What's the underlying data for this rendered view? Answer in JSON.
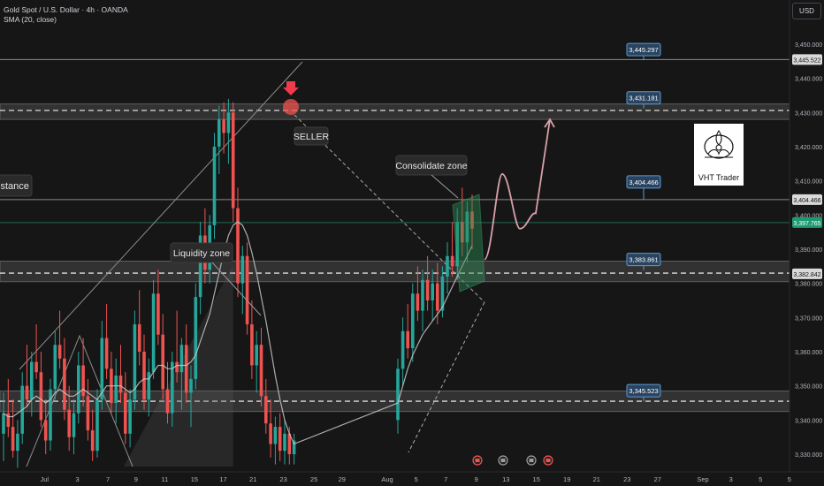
{
  "header": {
    "symbol_line": "Gold Spot / U.S. Dollar · 4h · OANDA",
    "indicator_line": "SMA (20, close)"
  },
  "currency_button": "USD",
  "logo": {
    "text": "VHT Trader"
  },
  "annotations": {
    "seller": "SELLER",
    "consolidate": "Consolidate zone",
    "liquidity": "Liquidity zone",
    "resistance_partial": "istance"
  },
  "colors": {
    "background": "#161616",
    "bull": "#26a69a",
    "bear": "#ef5350",
    "sma": "#c8c8c8",
    "zone_fill": "#4a4a4a",
    "label_box": "#2a4460",
    "label_border": "#5b9bd5",
    "price_box_green": "#1e9a72",
    "projection": "#d9a0aa",
    "consolidate_box": "#2e8b57"
  },
  "chart_data": {
    "type": "candlestick",
    "symbol": "Gold Spot / U.S. Dollar",
    "timeframe": "4h",
    "source": "OANDA",
    "indicator": "SMA (20, close)",
    "currency": "USD",
    "ylim": [
      3327,
      3453
    ],
    "y_ticks": [
      3330,
      3340,
      3350,
      3360,
      3370,
      3380,
      3390,
      3400,
      3410,
      3420,
      3430,
      3440,
      3450
    ],
    "y_tick_labels": [
      "3,330.000",
      "3,340.000",
      "3,350.000",
      "3,360.000",
      "3,370.000",
      "3,380.000",
      "3,390.000",
      "3,400.000",
      "3,410.000",
      "3,420.000",
      "3,430.000",
      "3,440.000",
      "3,450.000"
    ],
    "x_ticks": [
      {
        "label": "Jul",
        "pos": 0.054
      },
      {
        "label": "3",
        "pos": 0.094
      },
      {
        "label": "7",
        "pos": 0.131
      },
      {
        "label": "9",
        "pos": 0.165
      },
      {
        "label": "11",
        "pos": 0.2
      },
      {
        "label": "15",
        "pos": 0.236
      },
      {
        "label": "17",
        "pos": 0.271
      },
      {
        "label": "21",
        "pos": 0.307
      },
      {
        "label": "23",
        "pos": 0.344
      },
      {
        "label": "25",
        "pos": 0.381
      },
      {
        "label": "29",
        "pos": 0.415
      },
      {
        "label": "Aug",
        "pos": 0.47
      },
      {
        "label": "5",
        "pos": 0.505
      },
      {
        "label": "7",
        "pos": 0.541
      },
      {
        "label": "9",
        "pos": 0.578
      },
      {
        "label": "13",
        "pos": 0.614
      },
      {
        "label": "15",
        "pos": 0.651
      },
      {
        "label": "19",
        "pos": 0.688
      },
      {
        "label": "21",
        "pos": 0.724
      },
      {
        "label": "23",
        "pos": 0.761
      },
      {
        "label": "27",
        "pos": 0.798
      },
      {
        "label": "Sep",
        "pos": 0.853
      },
      {
        "label": "3",
        "pos": 0.887
      },
      {
        "label": "5",
        "pos": 0.923
      },
      {
        "label": "5",
        "pos": 0.958
      }
    ],
    "price_labels": [
      {
        "text": "3,445.297",
        "value": 3445.3
      },
      {
        "text": "3,431.181",
        "value": 3431.2
      },
      {
        "text": "3,404.466",
        "value": 3404.5
      },
      {
        "text": "3,383.861",
        "value": 3383.9
      },
      {
        "text": "3,345.523",
        "value": 3345.5
      }
    ],
    "right_labels": [
      {
        "text": "3,445.522",
        "value": 3445.5,
        "style": "white"
      },
      {
        "text": "3,404.466",
        "value": 3404.5,
        "style": "white"
      },
      {
        "text": "3,397.765",
        "value": 3397.8,
        "style": "green"
      },
      {
        "text": "3,382.842",
        "value": 3382.8,
        "style": "white"
      }
    ],
    "horizontal_lines": [
      3445.5,
      3404.5,
      3397.8
    ],
    "zones": [
      {
        "top": 3432.5,
        "bottom": 3428.0,
        "mid": 3430.6
      },
      {
        "top": 3386.5,
        "bottom": 3380.5,
        "mid": 3383.0
      },
      {
        "top": 3348.5,
        "bottom": 3342.5,
        "mid": 3345.5
      }
    ],
    "candles": [
      {
        "o": 3336,
        "h": 3348,
        "l": 3328,
        "c": 3342
      },
      {
        "o": 3342,
        "h": 3352,
        "l": 3335,
        "c": 3338
      },
      {
        "o": 3338,
        "h": 3346,
        "l": 3329,
        "c": 3331
      },
      {
        "o": 3331,
        "h": 3340,
        "l": 3326,
        "c": 3336
      },
      {
        "o": 3336,
        "h": 3354,
        "l": 3333,
        "c": 3350
      },
      {
        "o": 3350,
        "h": 3362,
        "l": 3344,
        "c": 3346
      },
      {
        "o": 3346,
        "h": 3360,
        "l": 3341,
        "c": 3357
      },
      {
        "o": 3357,
        "h": 3368,
        "l": 3352,
        "c": 3354
      },
      {
        "o": 3354,
        "h": 3360,
        "l": 3338,
        "c": 3340
      },
      {
        "o": 3340,
        "h": 3346,
        "l": 3330,
        "c": 3334
      },
      {
        "o": 3334,
        "h": 3352,
        "l": 3331,
        "c": 3349
      },
      {
        "o": 3349,
        "h": 3366,
        "l": 3346,
        "c": 3362
      },
      {
        "o": 3362,
        "h": 3372,
        "l": 3355,
        "c": 3358
      },
      {
        "o": 3358,
        "h": 3364,
        "l": 3340,
        "c": 3343
      },
      {
        "o": 3343,
        "h": 3350,
        "l": 3331,
        "c": 3335
      },
      {
        "o": 3335,
        "h": 3346,
        "l": 3330,
        "c": 3342
      },
      {
        "o": 3342,
        "h": 3360,
        "l": 3339,
        "c": 3356
      },
      {
        "o": 3356,
        "h": 3364,
        "l": 3344,
        "c": 3347
      },
      {
        "o": 3347,
        "h": 3352,
        "l": 3334,
        "c": 3337
      },
      {
        "o": 3337,
        "h": 3343,
        "l": 3328,
        "c": 3331
      },
      {
        "o": 3331,
        "h": 3349,
        "l": 3329,
        "c": 3346
      },
      {
        "o": 3346,
        "h": 3369,
        "l": 3343,
        "c": 3364
      },
      {
        "o": 3364,
        "h": 3374,
        "l": 3352,
        "c": 3355
      },
      {
        "o": 3355,
        "h": 3360,
        "l": 3342,
        "c": 3345
      },
      {
        "o": 3345,
        "h": 3358,
        "l": 3339,
        "c": 3353
      },
      {
        "o": 3353,
        "h": 3362,
        "l": 3345,
        "c": 3348
      },
      {
        "o": 3348,
        "h": 3354,
        "l": 3333,
        "c": 3336
      },
      {
        "o": 3336,
        "h": 3349,
        "l": 3332,
        "c": 3346
      },
      {
        "o": 3346,
        "h": 3372,
        "l": 3343,
        "c": 3368
      },
      {
        "o": 3368,
        "h": 3378,
        "l": 3356,
        "c": 3360
      },
      {
        "o": 3360,
        "h": 3365,
        "l": 3343,
        "c": 3346
      },
      {
        "o": 3346,
        "h": 3358,
        "l": 3341,
        "c": 3354
      },
      {
        "o": 3354,
        "h": 3381,
        "l": 3352,
        "c": 3377
      },
      {
        "o": 3377,
        "h": 3384,
        "l": 3362,
        "c": 3365
      },
      {
        "o": 3365,
        "h": 3371,
        "l": 3346,
        "c": 3349
      },
      {
        "o": 3349,
        "h": 3357,
        "l": 3339,
        "c": 3342
      },
      {
        "o": 3342,
        "h": 3360,
        "l": 3338,
        "c": 3357
      },
      {
        "o": 3357,
        "h": 3372,
        "l": 3351,
        "c": 3354
      },
      {
        "o": 3354,
        "h": 3364,
        "l": 3343,
        "c": 3362
      },
      {
        "o": 3362,
        "h": 3368,
        "l": 3345,
        "c": 3348
      },
      {
        "o": 3348,
        "h": 3356,
        "l": 3338,
        "c": 3352
      },
      {
        "o": 3352,
        "h": 3380,
        "l": 3349,
        "c": 3376
      },
      {
        "o": 3376,
        "h": 3398,
        "l": 3371,
        "c": 3394
      },
      {
        "o": 3394,
        "h": 3402,
        "l": 3380,
        "c": 3384
      },
      {
        "o": 3384,
        "h": 3400,
        "l": 3380,
        "c": 3397
      },
      {
        "o": 3397,
        "h": 3424,
        "l": 3393,
        "c": 3420
      },
      {
        "o": 3420,
        "h": 3432,
        "l": 3412,
        "c": 3428
      },
      {
        "o": 3428,
        "h": 3433,
        "l": 3418,
        "c": 3424
      },
      {
        "o": 3424,
        "h": 3434,
        "l": 3415,
        "c": 3430
      },
      {
        "o": 3430,
        "h": 3433,
        "l": 3398,
        "c": 3402
      },
      {
        "o": 3402,
        "h": 3408,
        "l": 3376,
        "c": 3380
      },
      {
        "o": 3380,
        "h": 3391,
        "l": 3371,
        "c": 3388
      },
      {
        "o": 3388,
        "h": 3392,
        "l": 3365,
        "c": 3368
      },
      {
        "o": 3368,
        "h": 3375,
        "l": 3352,
        "c": 3356
      },
      {
        "o": 3356,
        "h": 3366,
        "l": 3348,
        "c": 3362
      },
      {
        "o": 3362,
        "h": 3367,
        "l": 3344,
        "c": 3347
      },
      {
        "o": 3347,
        "h": 3352,
        "l": 3336,
        "c": 3339
      },
      {
        "o": 3339,
        "h": 3346,
        "l": 3329,
        "c": 3333
      },
      {
        "o": 3333,
        "h": 3341,
        "l": 3327,
        "c": 3338
      },
      {
        "o": 3338,
        "h": 3342,
        "l": 3328,
        "c": 3331
      },
      {
        "o": 3331,
        "h": 3340,
        "l": 3327,
        "c": 3336
      },
      {
        "o": 3336,
        "h": 3338,
        "l": 3327,
        "c": 3330
      },
      {
        "o": 3330,
        "h": 3336,
        "l": 3327,
        "c": 3334
      },
      {
        "o": 3340,
        "h": 3358,
        "l": 3336,
        "c": 3355
      },
      {
        "o": 3355,
        "h": 3370,
        "l": 3350,
        "c": 3366
      },
      {
        "o": 3366,
        "h": 3374,
        "l": 3358,
        "c": 3361
      },
      {
        "o": 3361,
        "h": 3380,
        "l": 3357,
        "c": 3377
      },
      {
        "o": 3377,
        "h": 3385,
        "l": 3369,
        "c": 3372
      },
      {
        "o": 3372,
        "h": 3384,
        "l": 3366,
        "c": 3381
      },
      {
        "o": 3381,
        "h": 3388,
        "l": 3372,
        "c": 3375
      },
      {
        "o": 3375,
        "h": 3384,
        "l": 3369,
        "c": 3380
      },
      {
        "o": 3380,
        "h": 3386,
        "l": 3368,
        "c": 3372
      },
      {
        "o": 3372,
        "h": 3385,
        "l": 3370,
        "c": 3382
      },
      {
        "o": 3382,
        "h": 3392,
        "l": 3377,
        "c": 3388
      },
      {
        "o": 3388,
        "h": 3398,
        "l": 3382,
        "c": 3385
      },
      {
        "o": 3385,
        "h": 3402,
        "l": 3381,
        "c": 3398
      },
      {
        "o": 3398,
        "h": 3408,
        "l": 3388,
        "c": 3392
      },
      {
        "o": 3392,
        "h": 3404,
        "l": 3386,
        "c": 3401
      },
      {
        "o": 3401,
        "h": 3406,
        "l": 3390,
        "c": 3396
      }
    ],
    "sma": [
      3342,
      3341,
      3341,
      3342,
      3343,
      3344,
      3346,
      3347,
      3346,
      3345,
      3346,
      3348,
      3349,
      3348,
      3347,
      3347,
      3348,
      3349,
      3348,
      3347,
      3346,
      3348,
      3350,
      3350,
      3350,
      3350,
      3349,
      3348,
      3349,
      3351,
      3352,
      3352,
      3354,
      3356,
      3356,
      3355,
      3355,
      3356,
      3356,
      3356,
      3357,
      3359,
      3363,
      3367,
      3371,
      3377,
      3383,
      3389,
      3394,
      3397,
      3398,
      3397,
      3394,
      3389,
      3383,
      3376,
      3369,
      3361,
      3353,
      3346,
      3340,
      3336,
      3333,
      3345,
      3350,
      3355,
      3359,
      3362,
      3365,
      3367,
      3369,
      3371,
      3373,
      3376,
      3379,
      3382,
      3385,
      3388,
      3391
    ],
    "projection_path": [
      3387,
      3399,
      3412,
      3396,
      3401,
      3428
    ],
    "calendar_icons": 4
  }
}
